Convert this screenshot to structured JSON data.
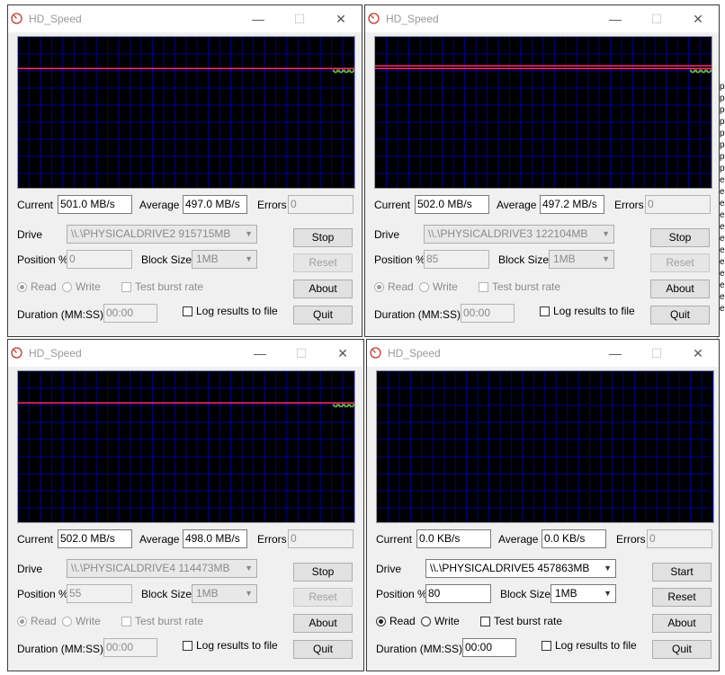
{
  "background_panel": {
    "chars": [
      "p",
      "p",
      "p",
      "p",
      "p",
      "p",
      "p",
      "p",
      "e",
      "e",
      "e",
      "e",
      "e",
      "e",
      "e",
      "e",
      "e",
      "e",
      "e",
      "e"
    ]
  },
  "windows": [
    {
      "title": "HD_Speed",
      "current": "501.0 MB/s",
      "average": "497.0 MB/s",
      "errors": "0",
      "drive": "\\\\.\\PHYSICALDRIVE2   915715MB",
      "position": "0",
      "block_size": "1MB",
      "duration": "00:00",
      "start_stop": "Stop",
      "running": true,
      "read_selected": true,
      "trace_level": 0.79
    },
    {
      "title": "HD_Speed",
      "current": "502.0 MB/s",
      "average": "497.2 MB/s",
      "errors": "0",
      "drive": "\\\\.\\PHYSICALDRIVE3   122104MB",
      "position": "85",
      "block_size": "1MB",
      "duration": "00:00",
      "start_stop": "Stop",
      "running": true,
      "read_selected": true,
      "trace_level": 0.79
    },
    {
      "title": "HD_Speed",
      "current": "502.0 MB/s",
      "average": "498.0 MB/s",
      "errors": "0",
      "drive": "\\\\.\\PHYSICALDRIVE4   114473MB",
      "position": "55",
      "block_size": "1MB",
      "duration": "00:00",
      "start_stop": "Stop",
      "running": true,
      "read_selected": true,
      "trace_level": 0.79
    },
    {
      "title": "HD_Speed",
      "current": "0.0 KB/s",
      "average": "0.0 KB/s",
      "errors": "0",
      "drive": "\\\\.\\PHYSICALDRIVE5   457863MB",
      "position": "80",
      "block_size": "1MB",
      "duration": "00:00",
      "start_stop": "Start",
      "running": false,
      "read_selected": true,
      "trace_level": null
    }
  ],
  "labels": {
    "current": "Current",
    "average": "Average",
    "errors": "Errors",
    "drive": "Drive",
    "position": "Position %",
    "block_size": "Block Size",
    "read": "Read",
    "write": "Write",
    "test_burst": "Test burst rate",
    "duration": "Duration (MM:SS)",
    "log_results": "Log results to file",
    "reset": "Reset",
    "about": "About",
    "quit": "Quit"
  },
  "titlebar_glyphs": {
    "minimize": "—",
    "maximize": "☐",
    "close": "✕"
  },
  "colors": {
    "graph_bg": "#000000",
    "grid_line": "#00008b",
    "trace_avg": "#ff2a6a",
    "trace_speed": "#7ccb4a"
  }
}
